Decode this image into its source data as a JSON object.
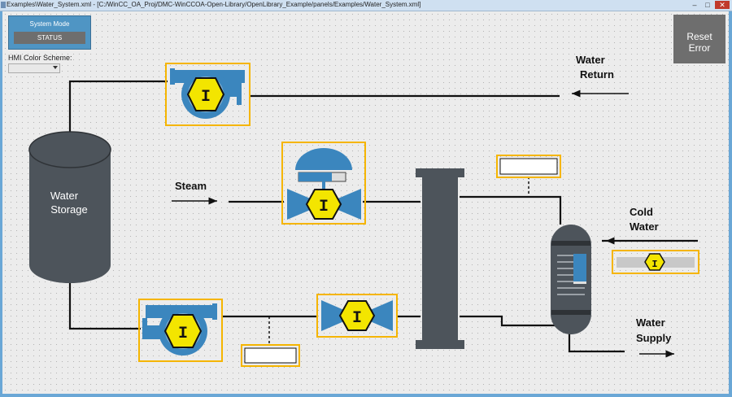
{
  "window": {
    "title": "Examples\\Water_System.xml - [C:/WinCC_OA_Proj/DMC-WinCCOA-Open-Library/OpenLibrary_Example/panels/Examples/Water_System.xml]",
    "minimize_label": "–",
    "maximize_label": "□",
    "close_label": "✕"
  },
  "system_mode": {
    "label": "System Mode",
    "status_label": "STATUS"
  },
  "hmi": {
    "label": "HMI Color Scheme:",
    "selected": ""
  },
  "reset": {
    "line1": "Reset",
    "line2": "Error"
  },
  "diagram": {
    "tank_label_1": "Water",
    "tank_label_2": "Storage",
    "steam_label": "Steam",
    "water_return_1": "Water",
    "water_return_2": "Return",
    "cold_water_1": "Cold",
    "cold_water_2": "Water",
    "water_supply_1": "Water",
    "water_supply_2": "Supply",
    "symbol_letter": "I"
  },
  "colors": {
    "accent_blue": "#3b86be",
    "highlight_border": "#f5b500",
    "symbol_yellow": "#f3e500",
    "vessel_gray": "#4d545b",
    "button_gray": "#6e6e6e"
  },
  "icons": [
    "pump-icon",
    "control-valve-icon",
    "valve-icon",
    "heat-exchanger-icon",
    "storage-tank-icon"
  ]
}
